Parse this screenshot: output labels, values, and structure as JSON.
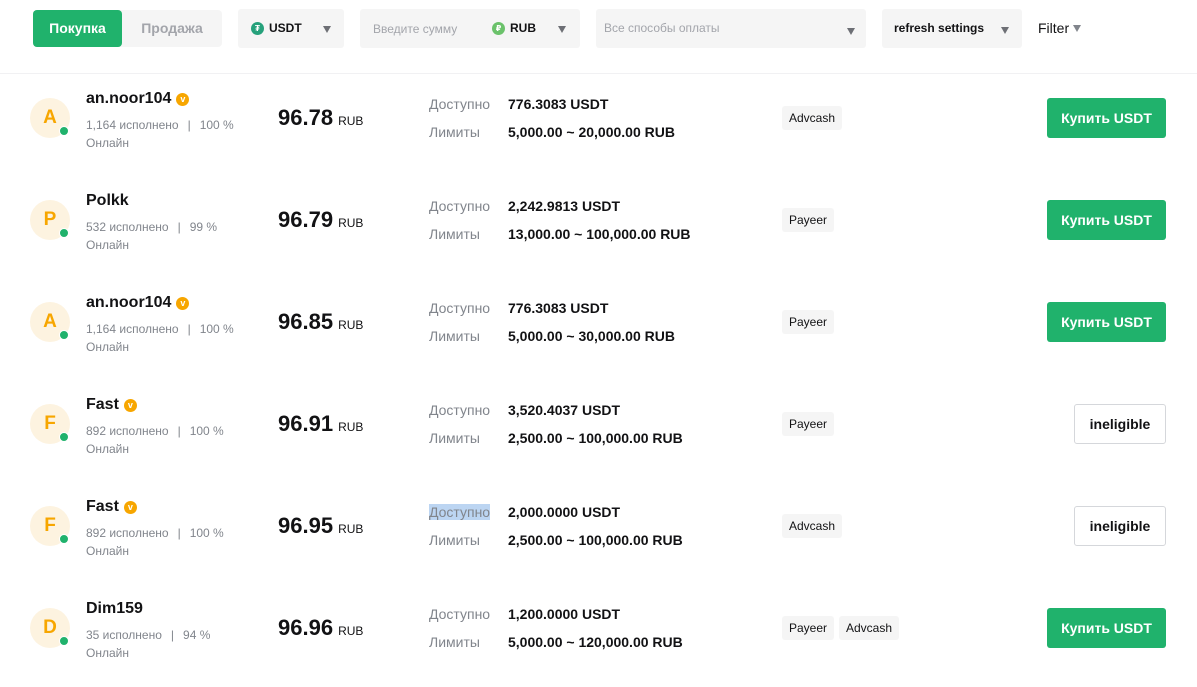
{
  "filters": {
    "side_tabs": {
      "buy": "Покупка",
      "sell": "Продажа"
    },
    "coin": {
      "value": "USDT",
      "icon": "tether-icon"
    },
    "amount": {
      "placeholder": "Введите сумму",
      "currency": "RUB",
      "icon": "ruble-icon"
    },
    "payment": {
      "placeholder": "Все способы оплаты"
    },
    "refresh": {
      "label": "refresh settings"
    },
    "filter": {
      "label": "Filter"
    }
  },
  "labels": {
    "available": "Доступно",
    "limits": "Лимиты"
  },
  "colors": {
    "accent_green": "#20b26c",
    "vip_gold": "#f7a600",
    "avatar_bg": "#fdf3e0",
    "chip_bg": "#f5f5f5"
  },
  "offers": [
    {
      "initial": "A",
      "nickname": "an.noor104",
      "verified": true,
      "orders": "1,164 исполнено",
      "completion": "100 %",
      "status": "Онлайн",
      "price": "96.78",
      "currency": "RUB",
      "available": "776.3083 USDT",
      "limits": "5,000.00 ~ 20,000.00 RUB",
      "payments": [
        "Advcash"
      ],
      "action": "Купить USDT",
      "eligible": true
    },
    {
      "initial": "P",
      "nickname": "Polkk",
      "verified": false,
      "orders": "532 исполнено",
      "completion": "99 %",
      "status": "Онлайн",
      "price": "96.79",
      "currency": "RUB",
      "available": "2,242.9813 USDT",
      "limits": "13,000.00 ~ 100,000.00 RUB",
      "payments": [
        "Payeer"
      ],
      "action": "Купить USDT",
      "eligible": true
    },
    {
      "initial": "A",
      "nickname": "an.noor104",
      "verified": true,
      "orders": "1,164 исполнено",
      "completion": "100 %",
      "status": "Онлайн",
      "price": "96.85",
      "currency": "RUB",
      "available": "776.3083 USDT",
      "limits": "5,000.00 ~ 30,000.00 RUB",
      "payments": [
        "Payeer"
      ],
      "action": "Купить USDT",
      "eligible": true
    },
    {
      "initial": "F",
      "nickname": "Fast",
      "verified": true,
      "orders": "892 исполнено",
      "completion": "100 %",
      "status": "Онлайн",
      "price": "96.91",
      "currency": "RUB",
      "available": "3,520.4037 USDT",
      "limits": "2,500.00 ~ 100,000.00 RUB",
      "payments": [
        "Payeer"
      ],
      "action": "ineligible",
      "eligible": false
    },
    {
      "initial": "F",
      "nickname": "Fast",
      "verified": true,
      "orders": "892 исполнено",
      "completion": "100 %",
      "status": "Онлайн",
      "price": "96.95",
      "currency": "RUB",
      "available": "2,000.0000 USDT",
      "limits": "2,500.00 ~ 100,000.00 RUB",
      "payments": [
        "Advcash"
      ],
      "action": "ineligible",
      "eligible": false,
      "available_label_selected": true
    },
    {
      "initial": "D",
      "nickname": "Dim159",
      "verified": false,
      "orders": "35 исполнено",
      "completion": "94 %",
      "status": "Онлайн",
      "price": "96.96",
      "currency": "RUB",
      "available": "1,200.0000 USDT",
      "limits": "5,000.00 ~ 120,000.00 RUB",
      "payments": [
        "Payeer",
        "Advcash"
      ],
      "action": "Купить USDT",
      "eligible": true
    }
  ]
}
